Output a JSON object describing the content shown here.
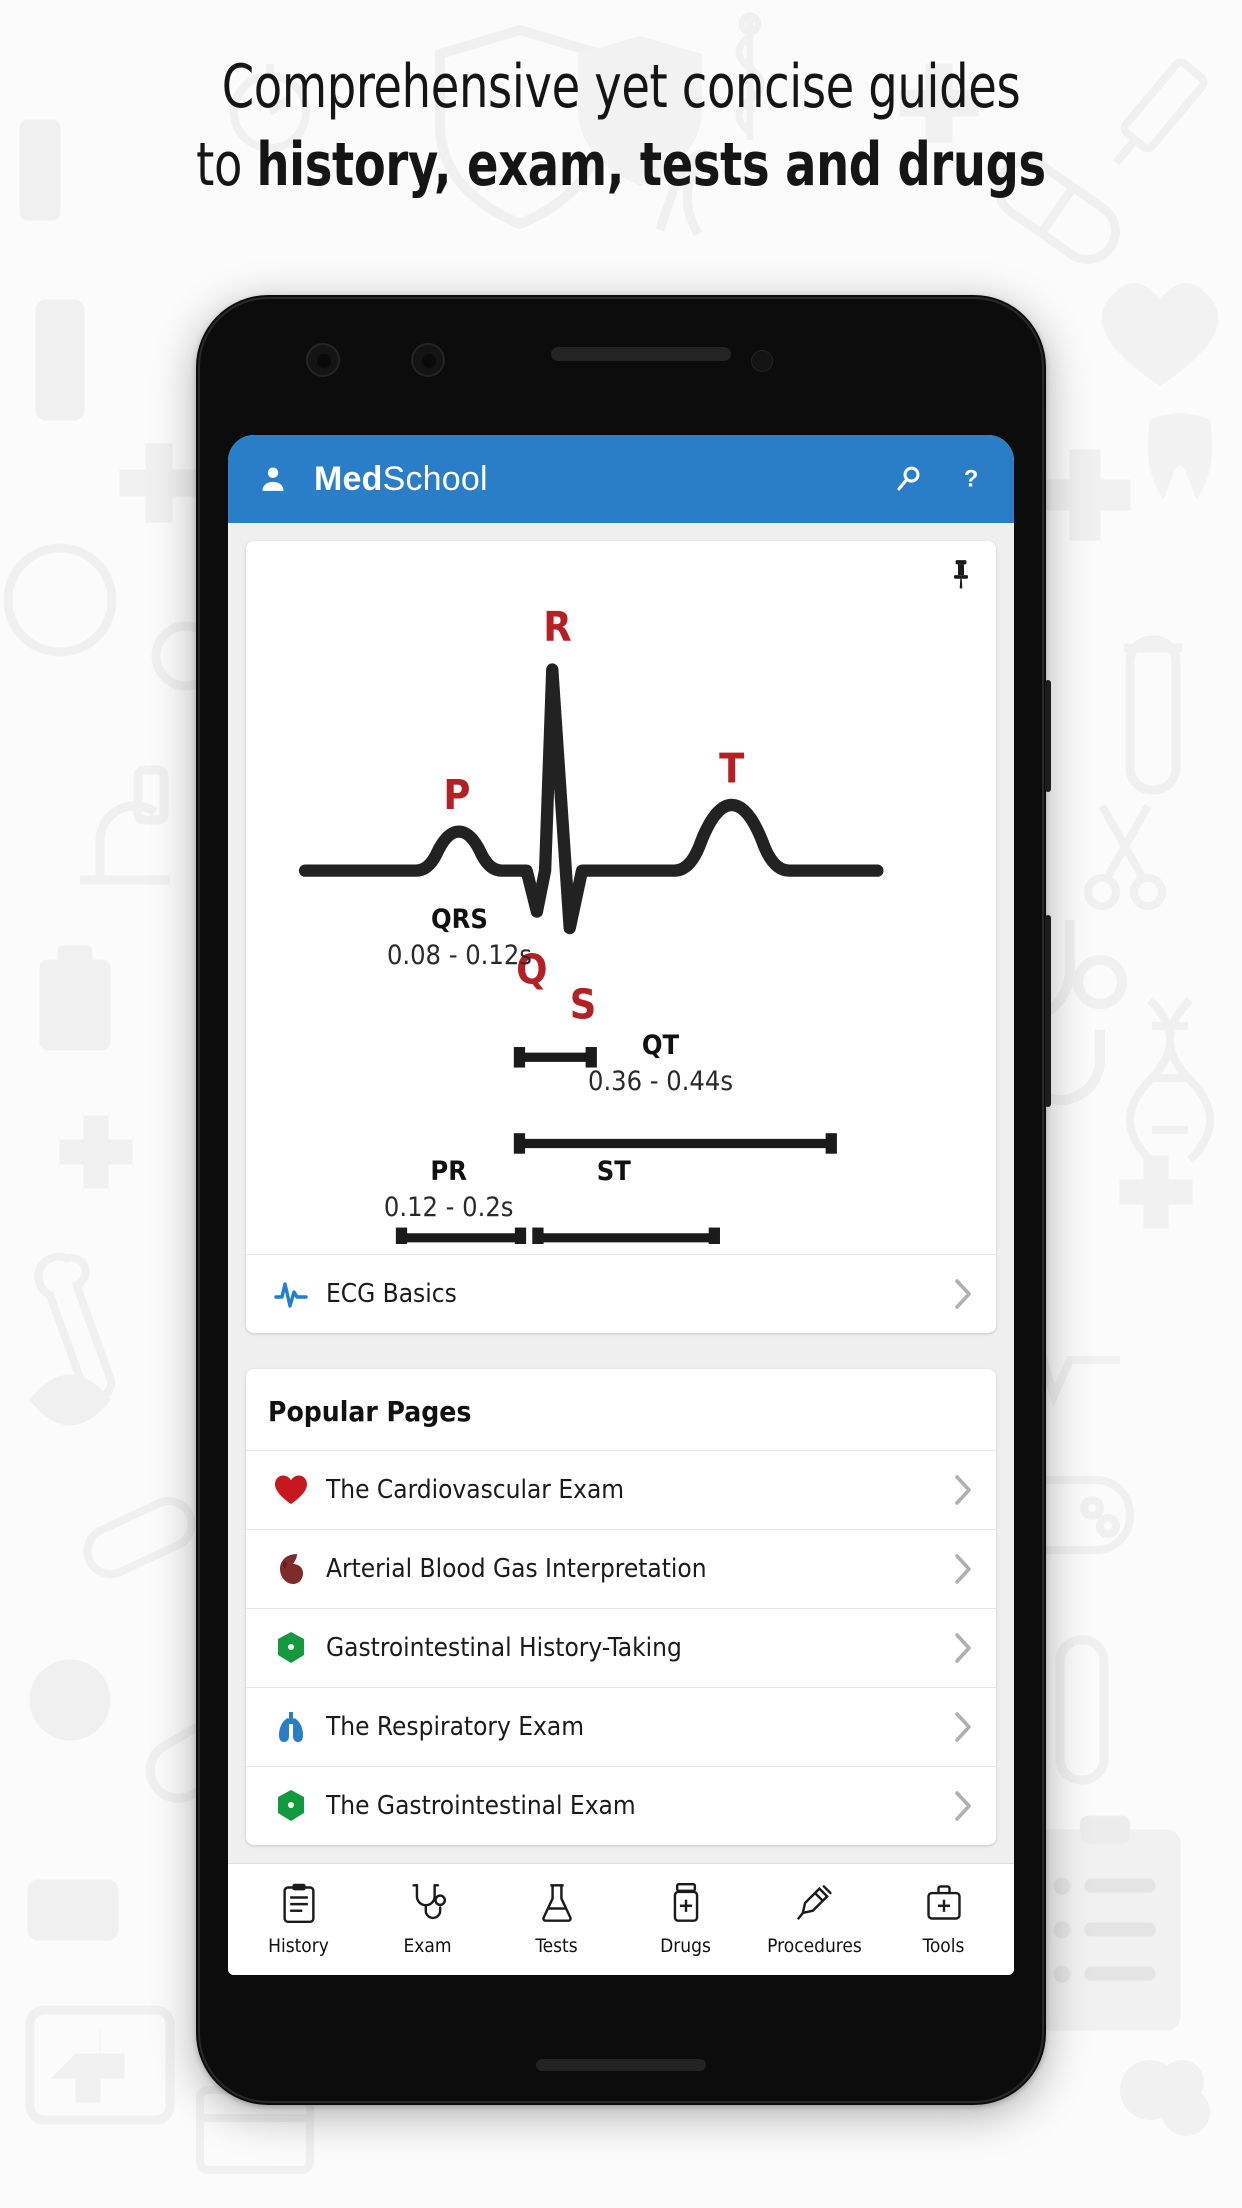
{
  "headline": {
    "line1": "Comprehensive yet concise guides",
    "line2_lead": "to ",
    "line2_strong": "history, exam, tests and drugs"
  },
  "colors": {
    "appbar_blue": "#2a7ec8",
    "ecg_label_red": "#b52025",
    "heart_red": "#c8181f",
    "gi_green": "#139a3e",
    "lung_blue": "#2a7ec8",
    "abg_maroon": "#7d2b2b",
    "page_background": "#fbfbfb"
  },
  "appbar": {
    "account_icon": "person-icon",
    "title_bold": "Med",
    "title_regular": "School",
    "search_icon": "search-icon",
    "help_icon": "help-icon"
  },
  "ecg_card": {
    "pin_icon": "pin-icon",
    "wave_labels": [
      "P",
      "Q",
      "R",
      "S",
      "T"
    ],
    "intervals": [
      {
        "name": "QRS",
        "value": "0.08 - 0.12s"
      },
      {
        "name": "QT",
        "value": "0.36 - 0.44s"
      },
      {
        "name": "PR",
        "value": "0.12 - 0.2s"
      },
      {
        "name": "ST",
        "value": ""
      }
    ],
    "link": {
      "label": "ECG Basics",
      "icon": "ecg-pulse-icon",
      "chevron": "chevron-right-icon"
    }
  },
  "popular": {
    "title": "Popular Pages",
    "items": [
      {
        "label": "The Cardiovascular Exam",
        "icon": "heart-icon",
        "chevron": "chevron-right-icon"
      },
      {
        "label": "Arterial Blood Gas Interpretation",
        "icon": "blood-drop-icon",
        "chevron": "chevron-right-icon"
      },
      {
        "label": "Gastrointestinal History-Taking",
        "icon": "stomach-icon",
        "chevron": "chevron-right-icon"
      },
      {
        "label": "The Respiratory Exam",
        "icon": "lungs-icon",
        "chevron": "chevron-right-icon"
      },
      {
        "label": "The Gastrointestinal Exam",
        "icon": "stomach-icon",
        "chevron": "chevron-right-icon"
      }
    ]
  },
  "bottom_nav": {
    "items": [
      {
        "label": "History",
        "icon": "clipboard-icon"
      },
      {
        "label": "Exam",
        "icon": "stethoscope-icon"
      },
      {
        "label": "Tests",
        "icon": "flask-icon"
      },
      {
        "label": "Drugs",
        "icon": "pill-bottle-icon"
      },
      {
        "label": "Procedures",
        "icon": "syringe-icon"
      },
      {
        "label": "Tools",
        "icon": "medical-bag-icon"
      }
    ]
  }
}
